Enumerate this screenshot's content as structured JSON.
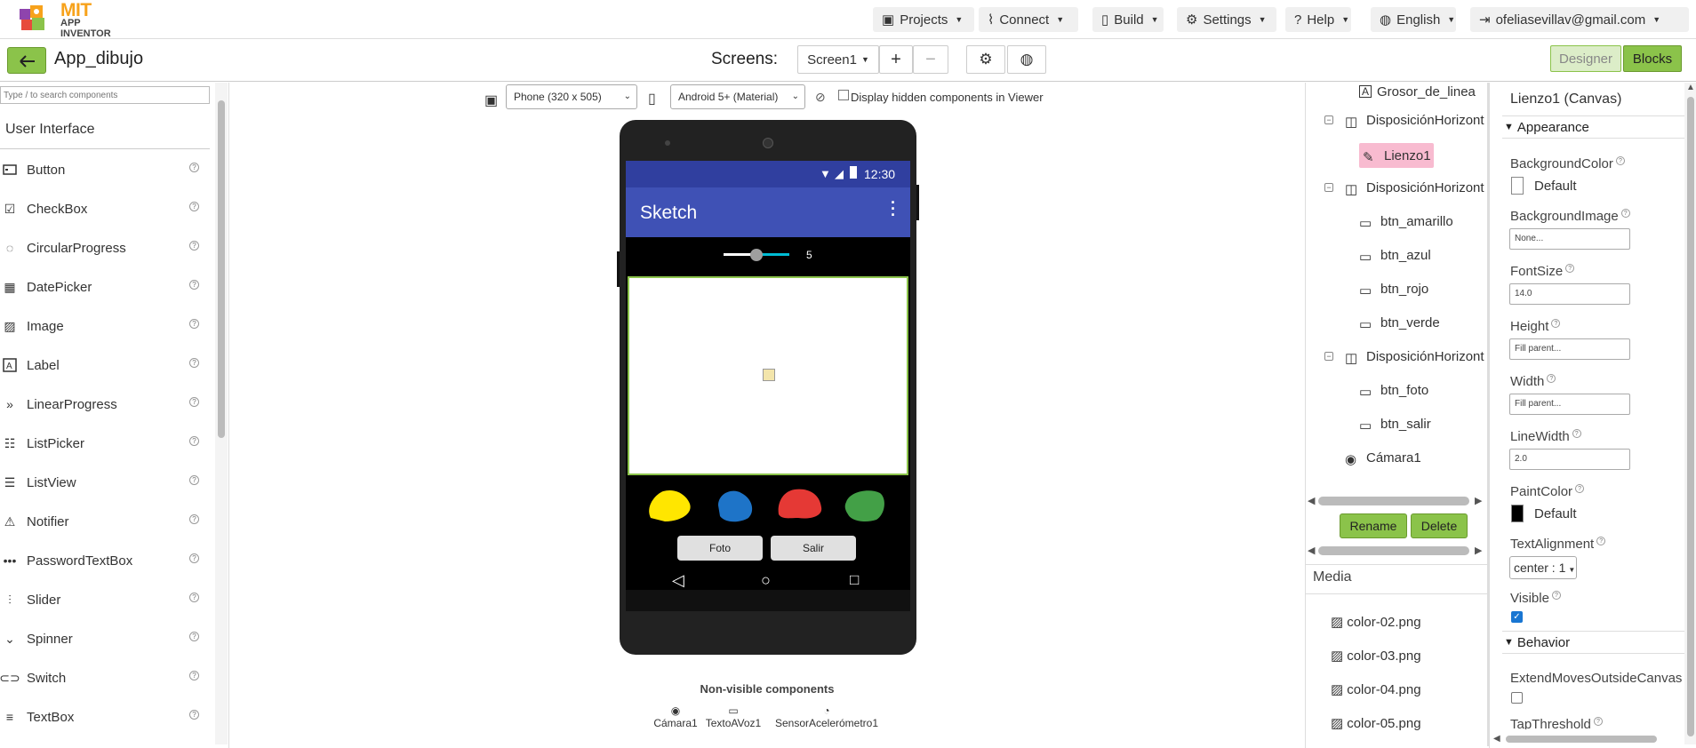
{
  "colors": {
    "accent_green": "#8bc34a",
    "phone_status": "#303f9f",
    "phone_title": "#3f51b5",
    "selected_bg": "#f8bbd0"
  },
  "topbar": {
    "logo_mit": "MIT",
    "logo_sub": "APP INVENTOR",
    "menus": [
      "Projects",
      "Connect",
      "Build",
      "Settings",
      "Help",
      "English",
      "ofeliasevillav@gmail.com"
    ]
  },
  "secondbar": {
    "app_name": "App_dibujo",
    "screens_label": "Screens:",
    "screen_select": "Screen1",
    "add": "+",
    "remove": "−",
    "designer": "Designer",
    "blocks": "Blocks"
  },
  "palette": {
    "search_placeholder": "Type / to search components",
    "category": "User Interface",
    "items": [
      "Button",
      "CheckBox",
      "CircularProgress",
      "DatePicker",
      "Image",
      "Label",
      "LinearProgress",
      "ListPicker",
      "ListView",
      "Notifier",
      "PasswordTextBox",
      "Slider",
      "Spinner",
      "Switch",
      "TextBox"
    ]
  },
  "viewer": {
    "phone_size": "Phone (320 x 505)",
    "theme": "Android 5+ (Material)",
    "hidden_label": "Display hidden components in Viewer",
    "time": "12:30",
    "app_title": "Sketch",
    "slider_value": "5",
    "btn_foto": "Foto",
    "btn_salir": "Salir",
    "nonvisible_label": "Non-visible components",
    "nonvisible": [
      "Cámara1",
      "TextoAVoz1",
      "SensorAcelerómetro1"
    ]
  },
  "tree": {
    "items": [
      "Grosor_de_linea",
      "DisposiciónHorizont",
      "Lienzo1",
      "DisposiciónHorizont",
      "btn_amarillo",
      "btn_azul",
      "btn_rojo",
      "btn_verde",
      "DisposiciónHorizont",
      "btn_foto",
      "btn_salir",
      "Cámara1"
    ],
    "rename": "Rename",
    "delete": "Delete",
    "media_title": "Media",
    "media": [
      "color-02.png",
      "color-03.png",
      "color-04.png",
      "color-05.png"
    ]
  },
  "props": {
    "title": "Lienzo1 (Canvas)",
    "appearance": "Appearance",
    "bg_color_label": "BackgroundColor",
    "bg_color_value": "Default",
    "bg_image_label": "BackgroundImage",
    "bg_image_value": "None...",
    "font_size_label": "FontSize",
    "font_size_value": "14.0",
    "height_label": "Height",
    "height_value": "Fill parent...",
    "width_label": "Width",
    "width_value": "Fill parent...",
    "line_width_label": "LineWidth",
    "line_width_value": "2.0",
    "paint_color_label": "PaintColor",
    "paint_color_value": "Default",
    "text_align_label": "TextAlignment",
    "text_align_value": "center : 1",
    "visible_label": "Visible",
    "behavior": "Behavior",
    "extend_label": "ExtendMovesOutsideCanvas",
    "tap_label": "TapThreshold"
  }
}
